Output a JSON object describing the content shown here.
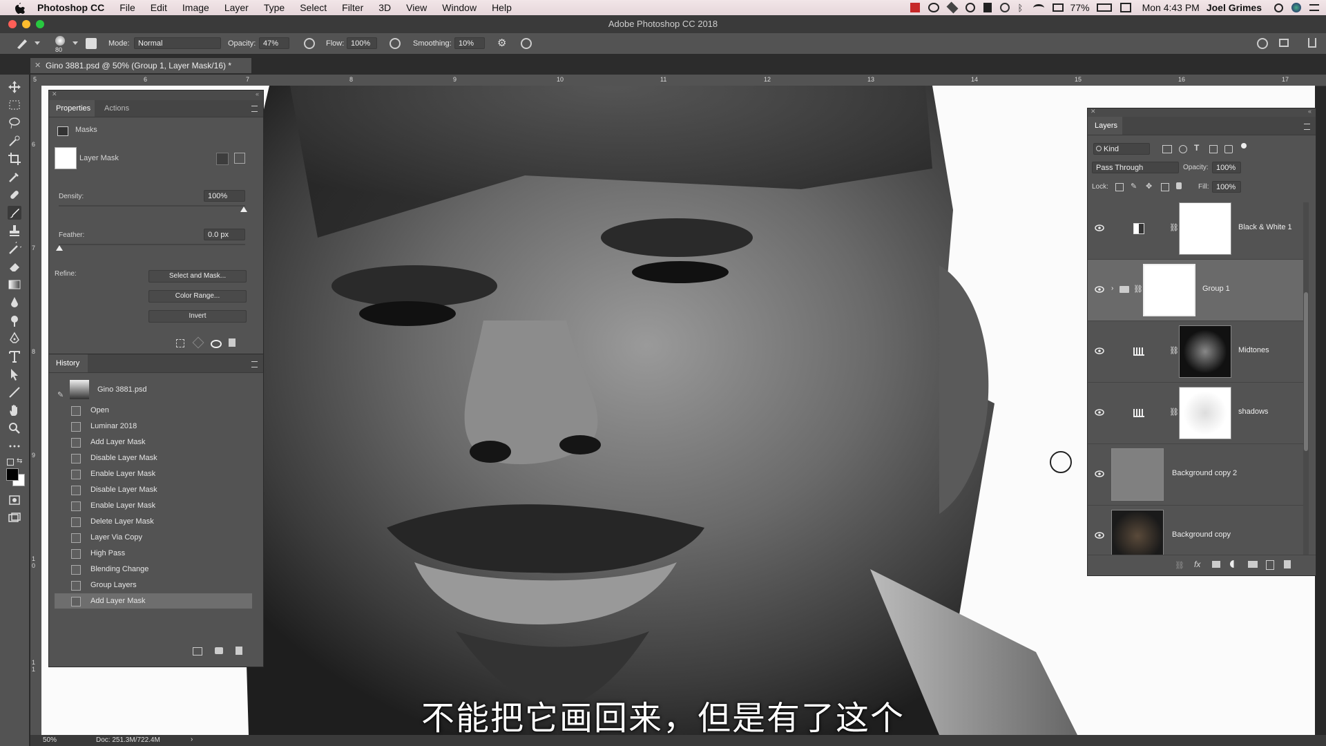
{
  "menubar": {
    "app_name": "Photoshop CC",
    "menus": [
      "File",
      "Edit",
      "Image",
      "Layer",
      "Type",
      "Select",
      "Filter",
      "3D",
      "View",
      "Window",
      "Help"
    ],
    "battery": "77%",
    "clock": "Mon 4:43 PM",
    "user": "Joel Grimes"
  },
  "window": {
    "title": "Adobe Photoshop CC 2018"
  },
  "options": {
    "brush_size": "80",
    "mode_label": "Mode:",
    "mode_value": "Normal",
    "opacity_label": "Opacity:",
    "opacity_value": "47%",
    "flow_label": "Flow:",
    "flow_value": "100%",
    "smoothing_label": "Smoothing:",
    "smoothing_value": "10%"
  },
  "document": {
    "tab_label": "Gino 3881.psd @ 50% (Group 1, Layer Mask/16) *",
    "ruler_ticks": [
      "5",
      "6",
      "7",
      "8",
      "9",
      "10",
      "11",
      "12",
      "13",
      "14",
      "15",
      "16",
      "17"
    ],
    "vruler_ticks": [
      "6",
      "7",
      "8",
      "9",
      "1\n0",
      "1\n1"
    ]
  },
  "properties": {
    "tabs": [
      "Properties",
      "Actions"
    ],
    "section": "Masks",
    "mask_name": "Layer Mask",
    "density_label": "Density:",
    "density_value": "100%",
    "feather_label": "Feather:",
    "feather_value": "0.0 px",
    "refine_label": "Refine:",
    "btn_select_mask": "Select and Mask...",
    "btn_color_range": "Color Range...",
    "btn_invert": "Invert"
  },
  "history": {
    "title": "History",
    "snapshot": "Gino 3881.psd",
    "items": [
      "Open",
      "Luminar 2018",
      "Add Layer Mask",
      "Disable Layer Mask",
      "Enable Layer Mask",
      "Disable Layer Mask",
      "Enable Layer Mask",
      "Delete Layer Mask",
      "Layer Via Copy",
      "High Pass",
      "Blending Change",
      "Group Layers",
      "Add Layer Mask"
    ]
  },
  "layers": {
    "title": "Layers",
    "kind_label": "Kind",
    "blend_mode": "Pass Through",
    "opacity_label": "Opacity:",
    "opacity_value": "100%",
    "lock_label": "Lock:",
    "fill_label": "Fill:",
    "fill_value": "100%",
    "items": [
      {
        "name": "Black & White 1"
      },
      {
        "name": "Group 1"
      },
      {
        "name": "Midtones"
      },
      {
        "name": "shadows"
      },
      {
        "name": "Background copy 2"
      },
      {
        "name": "Background copy"
      }
    ]
  },
  "status": {
    "zoom": "50%",
    "doc": "Doc: 251.3M/722.4M"
  },
  "subtitle": "不能把它画回来，但是有了这个"
}
